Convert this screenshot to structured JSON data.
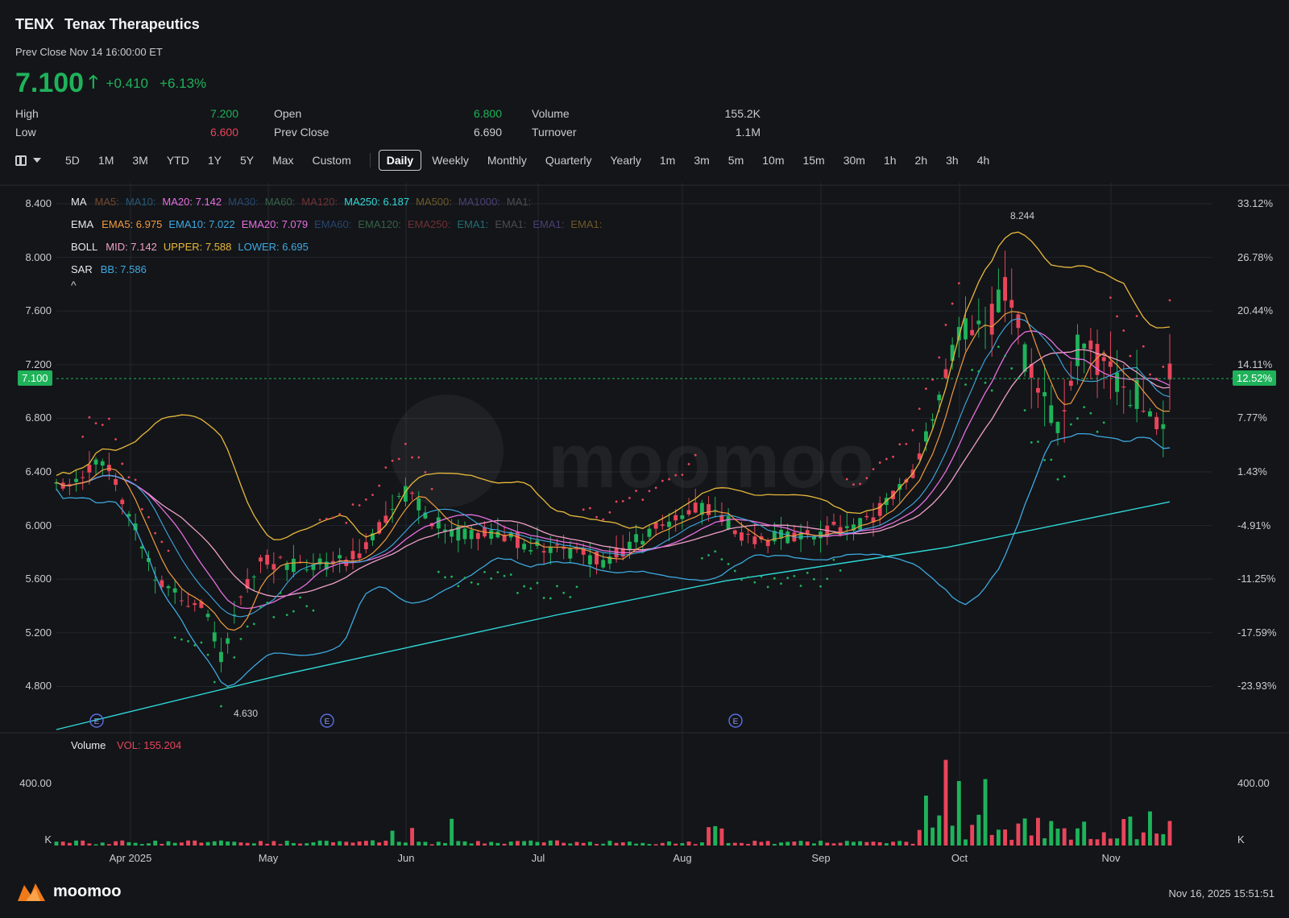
{
  "header": {
    "ticker": "TENX",
    "company": "Tenax Therapeutics",
    "prev_close_label": "Prev Close Nov 14 16:00:00 ET",
    "price": "7.100",
    "change": "+0.410",
    "change_pct": "+6.13%"
  },
  "stats": {
    "high_label": "High",
    "high": "7.200",
    "low_label": "Low",
    "low": "6.600",
    "open_label": "Open",
    "open": "6.800",
    "prev_close_label": "Prev Close",
    "prev_close": "6.690",
    "volume_label": "Volume",
    "volume": "155.2K",
    "turnover_label": "Turnover",
    "turnover": "1.1M"
  },
  "toolbar": {
    "ranges": [
      "5D",
      "1M",
      "3M",
      "YTD",
      "1Y",
      "5Y",
      "Max",
      "Custom"
    ],
    "intervals": [
      "Daily",
      "Weekly",
      "Monthly",
      "Quarterly",
      "Yearly",
      "1m",
      "3m",
      "5m",
      "10m",
      "15m",
      "30m",
      "1h",
      "2h",
      "3h",
      "4h"
    ],
    "active": "Daily"
  },
  "legends": {
    "ma": {
      "label": "MA",
      "items": [
        {
          "text": "MA5:",
          "color": "#e8823a",
          "dim": true
        },
        {
          "text": "MA10:",
          "color": "#3fa9e0",
          "dim": true
        },
        {
          "text": "MA20: 7.142",
          "color": "#e66fe0",
          "dim": false
        },
        {
          "text": "MA30:",
          "color": "#3f7fd6",
          "dim": true
        },
        {
          "text": "MA60:",
          "color": "#5fbf80",
          "dim": true
        },
        {
          "text": "MA120:",
          "color": "#e05050",
          "dim": true
        },
        {
          "text": "MA250: 6.187",
          "color": "#2fd8d8",
          "dim": false
        },
        {
          "text": "MA500:",
          "color": "#d6a83a",
          "dim": true
        },
        {
          "text": "MA1000:",
          "color": "#9070e0",
          "dim": true
        },
        {
          "text": "MA1:",
          "color": "#8a8d92",
          "dim": true
        }
      ]
    },
    "ema": {
      "label": "EMA",
      "items": [
        {
          "text": "EMA5: 6.975",
          "color": "#f09a3e",
          "dim": false
        },
        {
          "text": "EMA10: 7.022",
          "color": "#3fa9e0",
          "dim": false
        },
        {
          "text": "EMA20: 7.079",
          "color": "#e66fe0",
          "dim": false
        },
        {
          "text": "EMA60:",
          "color": "#3f7fd6",
          "dim": true
        },
        {
          "text": "EMA120:",
          "color": "#5fbf80",
          "dim": true
        },
        {
          "text": "EMA250:",
          "color": "#e05050",
          "dim": true
        },
        {
          "text": "EMA1:",
          "color": "#2fd8d8",
          "dim": true
        },
        {
          "text": "EMA1:",
          "color": "#8a8d92",
          "dim": true
        },
        {
          "text": "EMA1:",
          "color": "#9070e0",
          "dim": true
        },
        {
          "text": "EMA1:",
          "color": "#d6a83a",
          "dim": true
        }
      ]
    },
    "boll": {
      "label": "BOLL",
      "items": [
        {
          "text": "MID: 7.142",
          "color": "#f0a0c8",
          "dim": false
        },
        {
          "text": "UPPER: 7.588",
          "color": "#e8b83a",
          "dim": false
        },
        {
          "text": "LOWER: 6.695",
          "color": "#3fa9e0",
          "dim": false
        }
      ]
    },
    "sar": {
      "label": "SAR",
      "items": [
        {
          "text": "BB: 7.586",
          "color": "#3fa9e0",
          "dim": false
        }
      ]
    },
    "collapse": "^"
  },
  "axes": {
    "left_price": [
      "8.400",
      "8.000",
      "7.600",
      "7.200",
      "6.800",
      "6.400",
      "6.000",
      "5.600",
      "5.200",
      "4.800"
    ],
    "right_pct": [
      "33.12%",
      "26.78%",
      "20.44%",
      "14.11%",
      "7.77%",
      "1.43%",
      "-4.91%",
      "-11.25%",
      "-17.59%",
      "-23.93%"
    ],
    "current_price_tag": "7.100",
    "current_pct_tag": "12.52%",
    "months": [
      "Apr 2025",
      "May",
      "Jun",
      "Jul",
      "Aug",
      "Sep",
      "Oct",
      "Nov"
    ],
    "vol_left": [
      "400.00",
      "K"
    ],
    "vol_right": [
      "400.00",
      "K"
    ],
    "high_marker": "8.244",
    "low_marker": "4.630",
    "event_marker": "E"
  },
  "volume_legend": {
    "label": "Volume",
    "vol": "VOL: 155.204"
  },
  "footer": {
    "brand": "moomoo",
    "timestamp": "Nov 16, 2025 15:51:51"
  },
  "watermark": "moomoo",
  "colors": {
    "up": "#1fb25a",
    "down": "#e8455a",
    "bg": "#131519"
  },
  "chart_data": {
    "type": "candlestick",
    "title": "TENX Daily",
    "ylim": [
      4.5,
      8.55
    ],
    "months": [
      "Apr 2025",
      "May",
      "Jun",
      "Jul",
      "Aug",
      "Sep",
      "Oct",
      "Nov"
    ],
    "key_points": [
      [
        "2025-03-17",
        6.3
      ],
      [
        "2025-03-28",
        6.5
      ],
      [
        "2025-04-08",
        5.6
      ],
      [
        "2025-04-18",
        5.4
      ],
      [
        "2025-04-22",
        5.0
      ],
      [
        "2025-04-24",
        5.3
      ],
      [
        "2025-04-30",
        5.75
      ],
      [
        "2025-05-10",
        5.7
      ],
      [
        "2025-05-20",
        5.75
      ],
      [
        "2025-06-01",
        6.25
      ],
      [
        "2025-06-10",
        5.95
      ],
      [
        "2025-06-20",
        5.95
      ],
      [
        "2025-07-01",
        5.85
      ],
      [
        "2025-07-15",
        5.75
      ],
      [
        "2025-07-28",
        6.05
      ],
      [
        "2025-08-05",
        6.15
      ],
      [
        "2025-08-15",
        5.9
      ],
      [
        "2025-08-28",
        5.95
      ],
      [
        "2025-09-10",
        6.05
      ],
      [
        "2025-09-20",
        6.45
      ],
      [
        "2025-09-28",
        7.3
      ],
      [
        "2025-10-01",
        7.55
      ],
      [
        "2025-10-05",
        7.45
      ],
      [
        "2025-10-10",
        7.8
      ],
      [
        "2025-10-14",
        7.2
      ],
      [
        "2025-10-20",
        6.7
      ],
      [
        "2025-10-25",
        7.3
      ],
      [
        "2025-11-01",
        7.2
      ],
      [
        "2025-11-05",
        7.0
      ],
      [
        "2025-11-10",
        6.95
      ],
      [
        "2025-11-12",
        6.75
      ],
      [
        "2025-11-14",
        7.1
      ]
    ],
    "ma250": [
      [
        0,
        4.5
      ],
      [
        0.2,
        4.9
      ],
      [
        0.45,
        5.35
      ],
      [
        0.6,
        5.6
      ],
      [
        0.8,
        5.85
      ],
      [
        1.0,
        6.187
      ]
    ],
    "volume_peak_k": 560,
    "last_volume_k": 155.204
  }
}
